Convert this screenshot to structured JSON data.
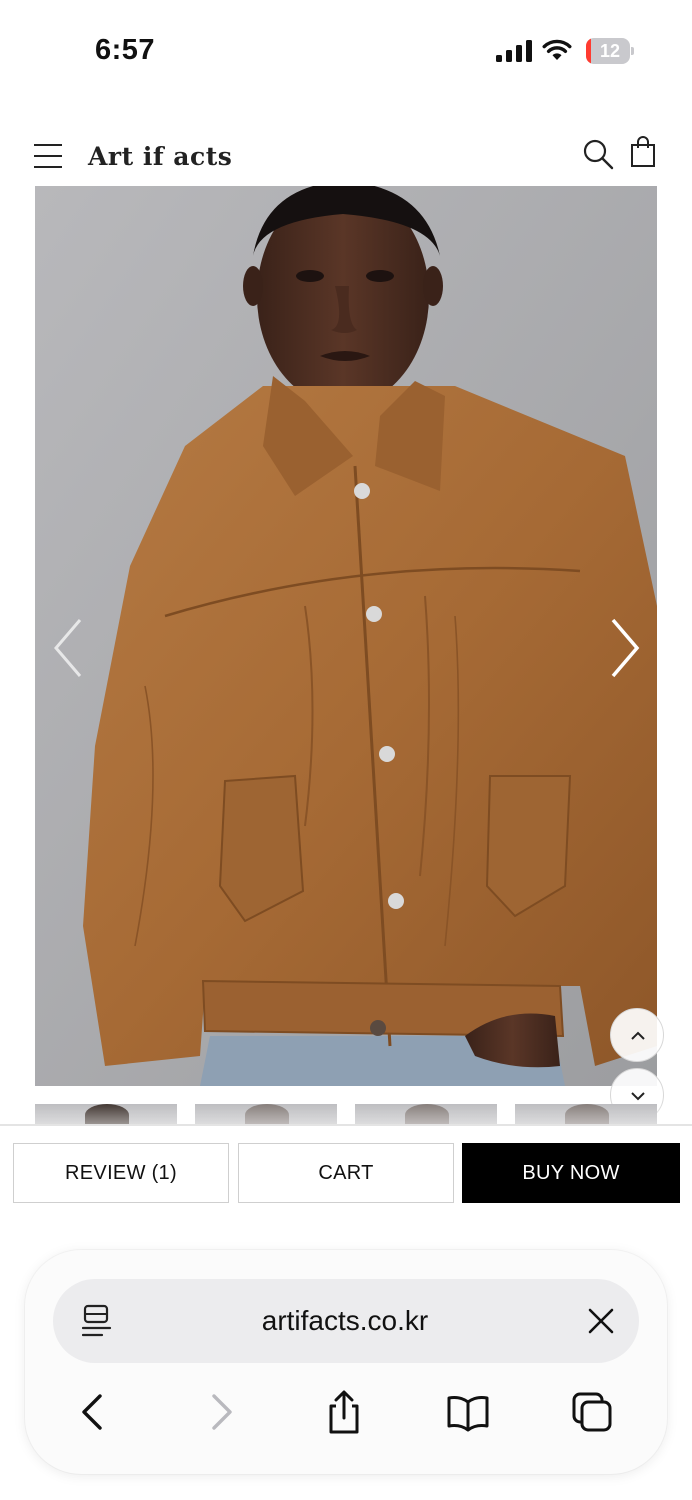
{
  "status_bar": {
    "time": "6:57",
    "battery_level": "12",
    "battery_fraction": 0.12,
    "battery_color": "#ff3b30"
  },
  "header": {
    "logo": "Art if acts",
    "icons": [
      "menu-icon",
      "search-icon",
      "shopping-bag-icon"
    ]
  },
  "gallery": {
    "prev_icon": "chevron-left-icon",
    "next_icon": "chevron-right-icon",
    "thumbnail_count_visible": 4,
    "jacket_color": "#a66a35",
    "background_color": "#a9aaad"
  },
  "scroll_controls": {
    "up_icon": "chevron-up-icon",
    "down_icon": "chevron-down-icon"
  },
  "actions": {
    "review_label": "REVIEW (1)",
    "cart_label": "CART",
    "buy_label": "BUY NOW"
  },
  "browser": {
    "url": "artifacts.co.kr",
    "icons": [
      "reader-icon",
      "close-icon",
      "back-icon",
      "forward-icon",
      "share-icon",
      "bookmarks-icon",
      "tabs-icon"
    ]
  }
}
